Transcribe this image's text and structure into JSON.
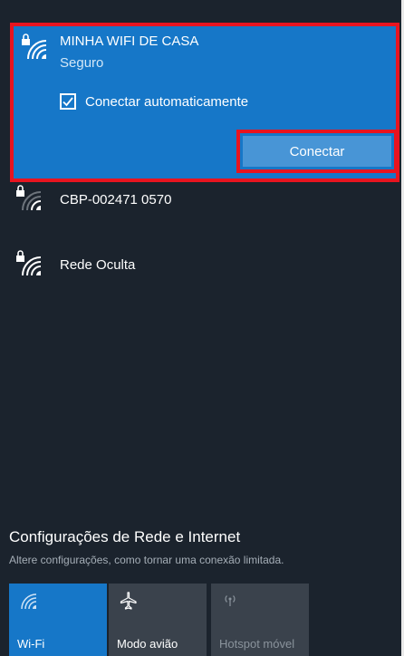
{
  "selected_network": {
    "ssid": "MINHA WIFI DE CASA",
    "status": "Seguro",
    "auto_connect_label": "Conectar automaticamente",
    "auto_connect_checked": true,
    "connect_label": "Conectar",
    "icon": "wifi-secured-icon"
  },
  "networks": [
    {
      "ssid": "CBP-002471 0570",
      "icon": "wifi-secured-weak-icon"
    },
    {
      "ssid": "Rede Oculta",
      "icon": "wifi-secured-icon"
    }
  ],
  "settings": {
    "link": "Configurações de Rede e Internet",
    "description": "Altere configurações, como tornar uma conexão limitada."
  },
  "quick_actions": [
    {
      "label": "Wi-Fi",
      "icon": "wifi-icon",
      "active": true
    },
    {
      "label": "Modo avião",
      "icon": "airplane-icon",
      "active": false
    },
    {
      "label": "Hotspot móvel",
      "icon": "hotspot-icon",
      "active": false,
      "disabled": true
    }
  ],
  "colors": {
    "panel_bg": "#1b232d",
    "accent": "#1677c8",
    "highlight": "#e8141f",
    "tile_bg": "#3a424c"
  }
}
